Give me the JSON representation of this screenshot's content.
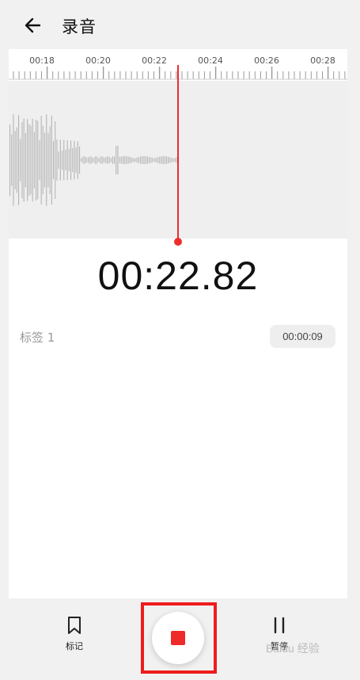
{
  "header": {
    "back_icon": "arrow-left-icon",
    "title": "录音"
  },
  "timeline": {
    "ticks": [
      "00:18",
      "00:20",
      "00:22",
      "00:24",
      "00:26",
      "00:28"
    ]
  },
  "recording": {
    "elapsed": "00:22.82"
  },
  "tags": [
    {
      "label": "标签 1",
      "time": "00:00:09"
    }
  ],
  "controls": {
    "mark_label": "标记",
    "mark_icon": "bookmark-icon",
    "stop_icon": "stop-icon",
    "pause_label": "暂停",
    "pause_icon": "pause-icon"
  },
  "colors": {
    "accent": "#ee2c2c",
    "highlight": "#ee1c1c"
  },
  "watermark": "Baidu 经验"
}
